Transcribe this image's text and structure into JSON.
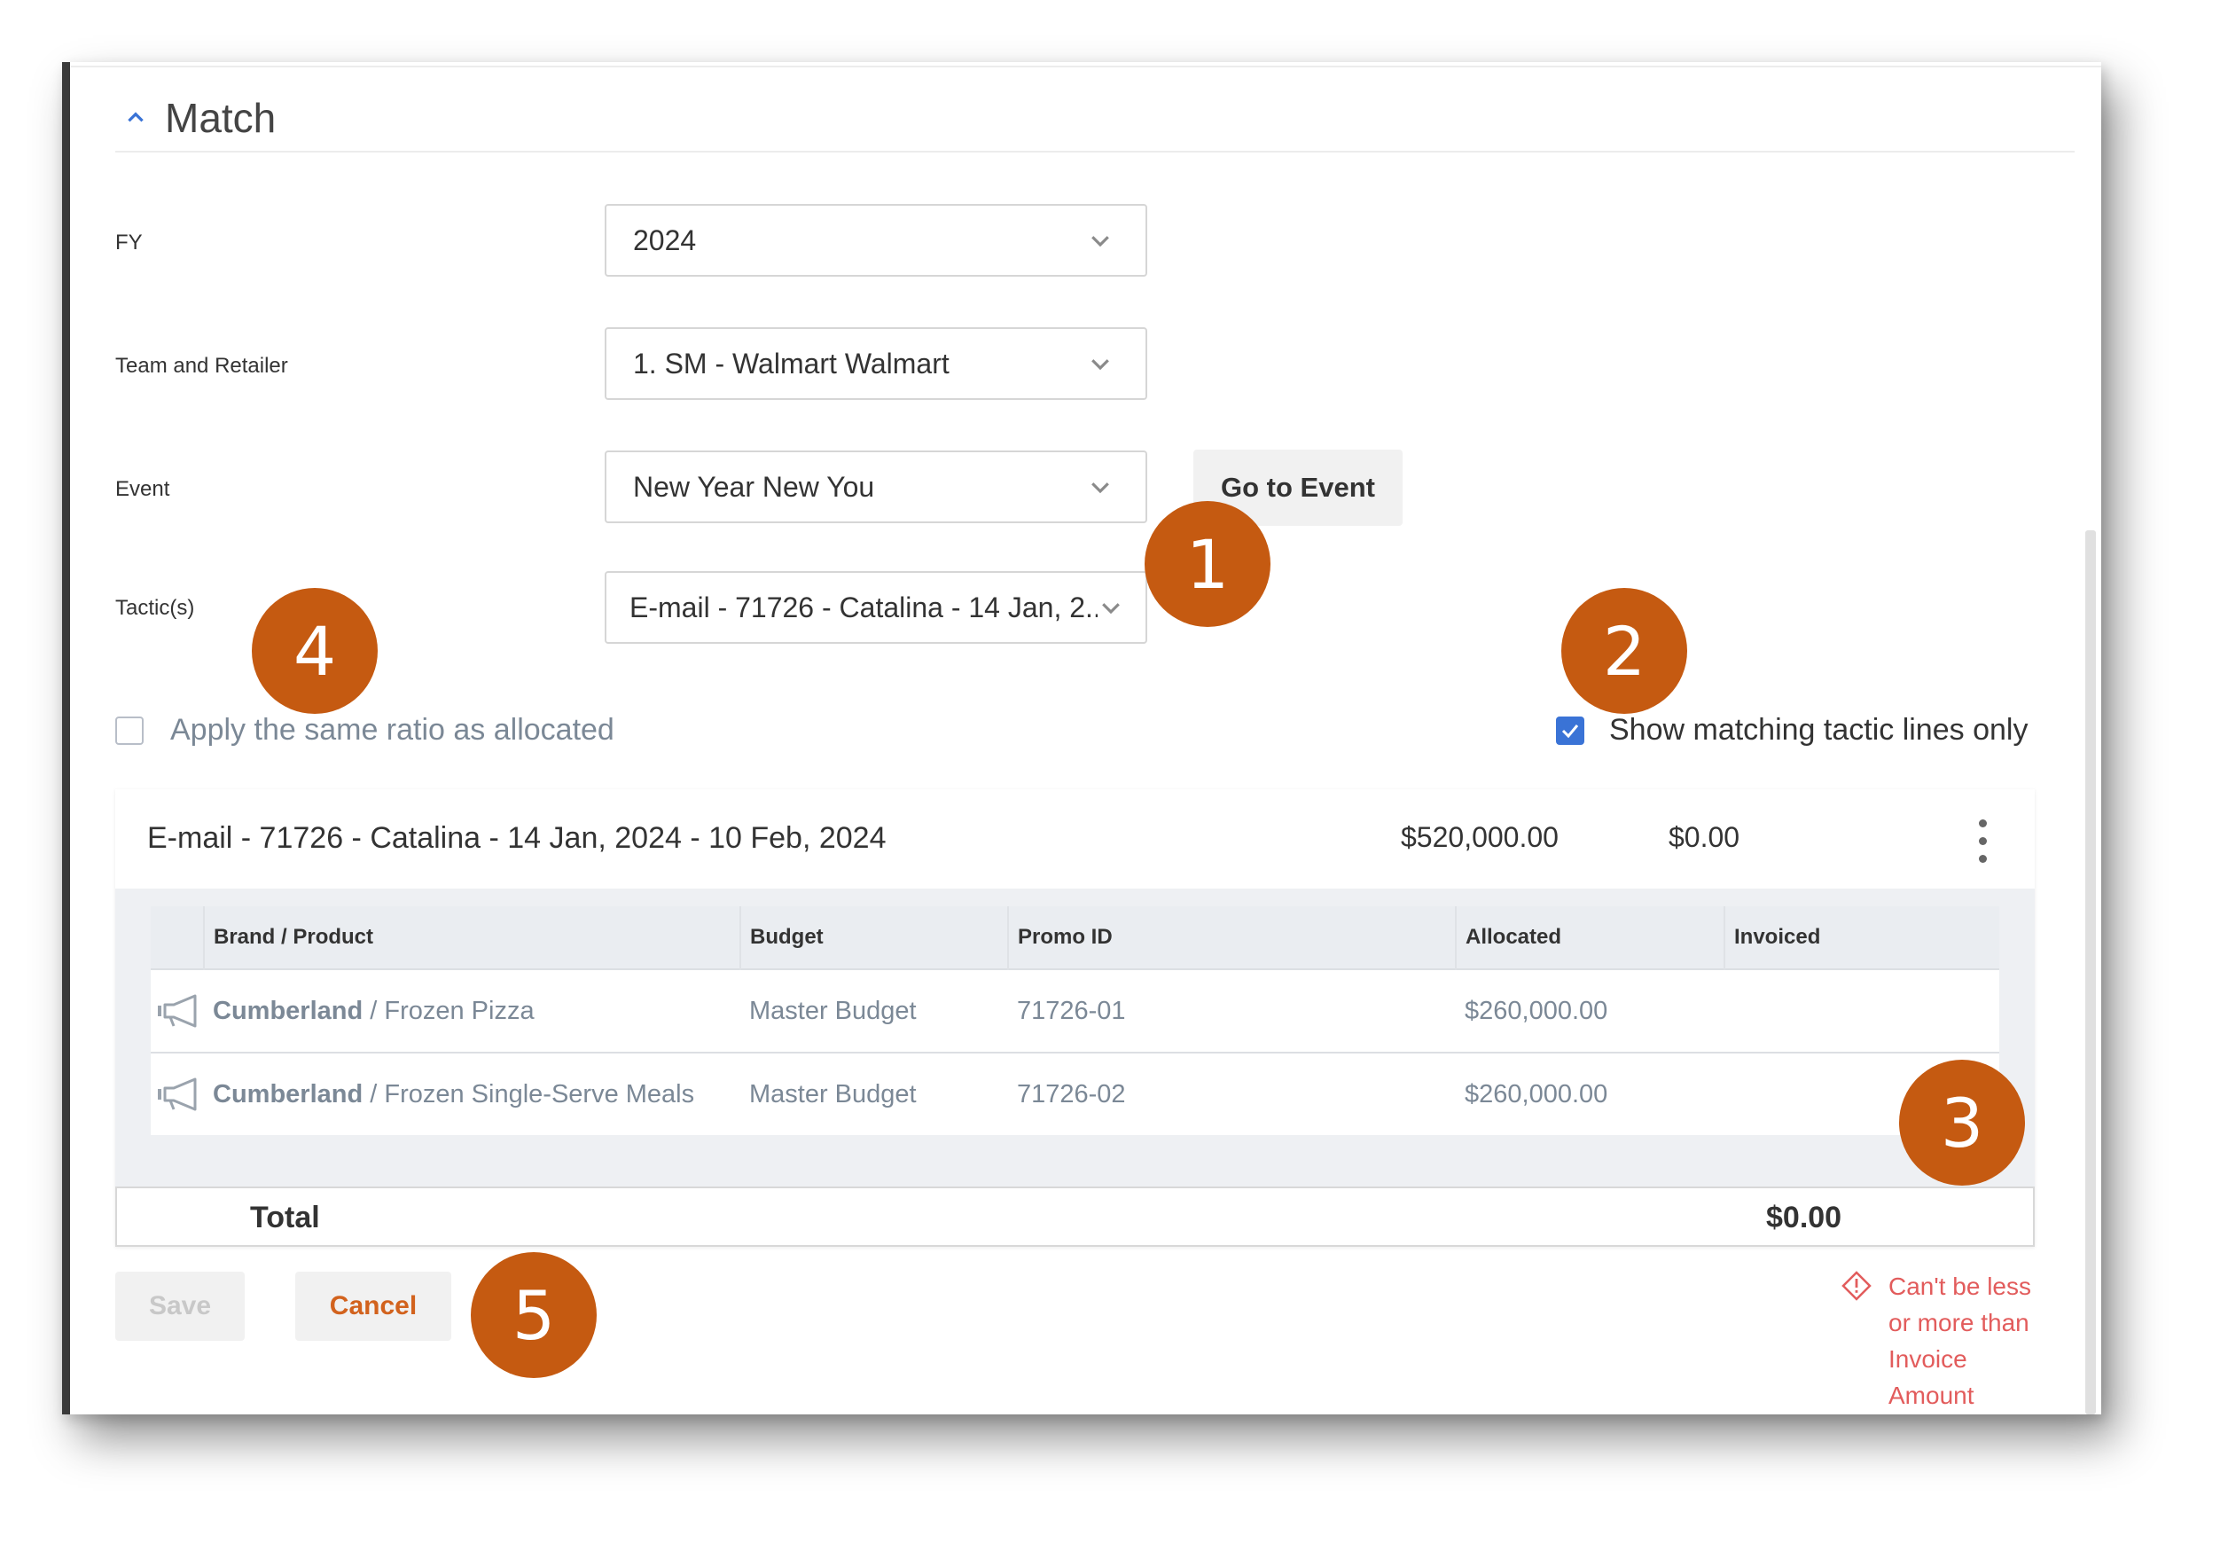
{
  "section": {
    "title": "Match"
  },
  "form": {
    "fy": {
      "label": "FY",
      "value": "2024"
    },
    "team": {
      "label": "Team and Retailer",
      "value": "1. SM - Walmart Walmart"
    },
    "event": {
      "label": "Event",
      "value": "New Year New You",
      "go_button": "Go to Event"
    },
    "tactics": {
      "label": "Tactic(s)",
      "value": "E-mail - 71726 - Catalina - 14 Jan, 2..."
    }
  },
  "options": {
    "apply_ratio": {
      "label": "Apply the same ratio as allocated",
      "checked": false
    },
    "show_matching": {
      "label": "Show matching tactic lines only",
      "checked": true
    }
  },
  "tactic_card": {
    "name": "E-mail - 71726 - Catalina - 14 Jan, 2024 - 10 Feb, 2024",
    "amount_allocated": "$520,000.00",
    "amount_invoiced": "$0.00",
    "columns": [
      "Brand / Product",
      "Budget",
      "Promo ID",
      "Allocated",
      "Invoiced"
    ],
    "rows": [
      {
        "brand": "Cumberland",
        "product": " / Frozen Pizza",
        "budget": "Master Budget",
        "promo_id": "71726-01",
        "allocated": "$260,000.00",
        "invoiced": ""
      },
      {
        "brand": "Cumberland",
        "product": " / Frozen Single-Serve Meals",
        "budget": "Master Budget",
        "promo_id": "71726-02",
        "allocated": "$260,000.00",
        "invoiced": ""
      }
    ],
    "total_label": "Total",
    "total_value": "$0.00"
  },
  "actions": {
    "save": "Save",
    "cancel": "Cancel"
  },
  "error": {
    "message": "Can't be less or more than Invoice Amount"
  },
  "markers": [
    "1",
    "2",
    "3",
    "4",
    "5"
  ],
  "colors": {
    "accent": "#3a73d6",
    "marker": "#c55a11",
    "error": "#e25c5c",
    "cancel": "#d2621d"
  }
}
